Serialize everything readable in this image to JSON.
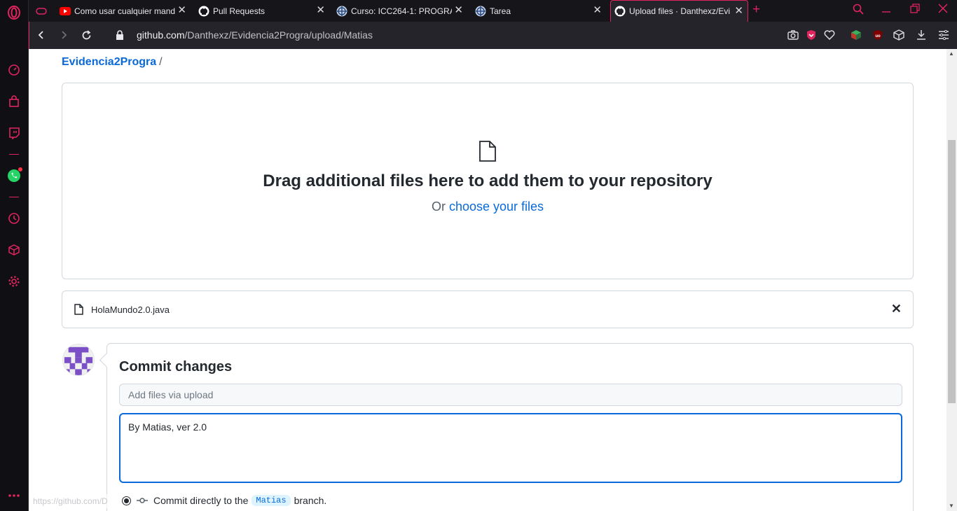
{
  "browser": {
    "tabs": [
      {
        "title": "Como usar cualquier mand",
        "favicon": "youtube-icon"
      },
      {
        "title": "Pull Requests",
        "favicon": "github-icon"
      },
      {
        "title": "Curso: ICC264-1: PROGRAM",
        "favicon": "moodle-icon"
      },
      {
        "title": "Tarea",
        "favicon": "moodle-icon"
      },
      {
        "title": "Upload files · Danthexz/Evi",
        "favicon": "github-icon",
        "active": true
      }
    ],
    "url_main": "github.com",
    "url_path": "/Danthexz/Evidencia2Progra/upload/Matias",
    "accent_color": "#e0245e"
  },
  "breadcrumb": {
    "repo": "Evidencia2Progra",
    "separator": "/"
  },
  "dropzone": {
    "title": "Drag additional files here to add them to your repository",
    "prefix": "Or",
    "link": "choose your files"
  },
  "file": {
    "name": "HolaMundo2.0.java",
    "remove": "✕"
  },
  "commit": {
    "title": "Commit changes",
    "summary_placeholder": "Add files via upload",
    "description": "By Matias, ver 2.0",
    "option_prefix": "Commit directly to the",
    "branch": "Matias",
    "option_suffix": "branch."
  },
  "status_bar": {
    "url": "https://github.com/D"
  }
}
